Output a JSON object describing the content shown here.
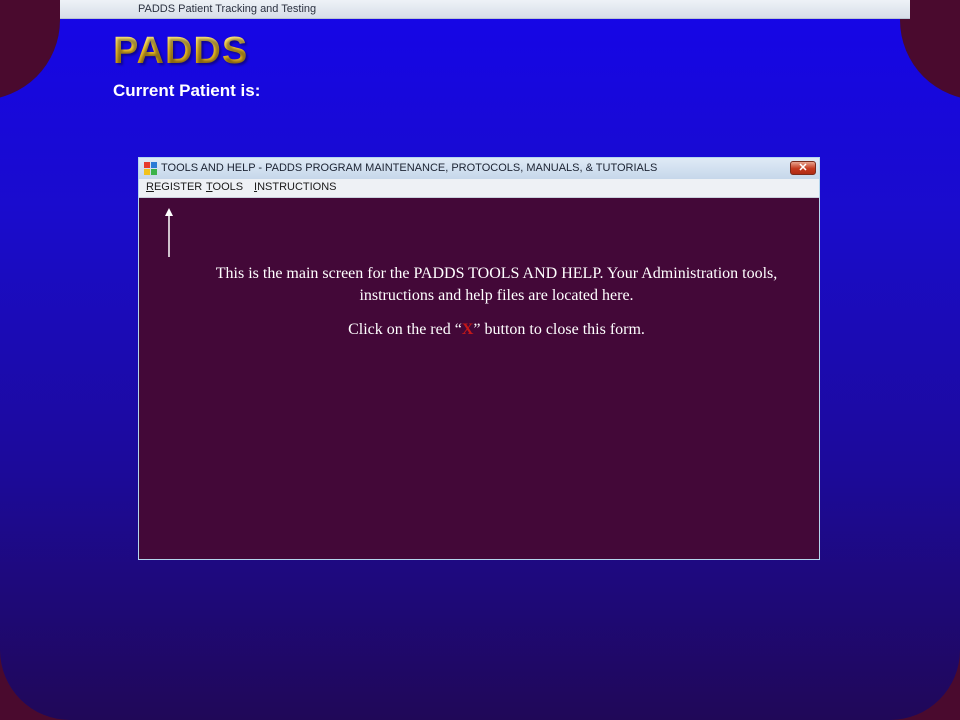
{
  "os_window": {
    "title": "PADDS Patient Tracking and Testing"
  },
  "app": {
    "logo": "PADDS",
    "current_patient_label": "Current Patient is:"
  },
  "dialog": {
    "title": "TOOLS AND HELP - PADDS PROGRAM MAINTENANCE, PROTOCOLS, MANUALS, & TUTORIALS",
    "close_label": "✕",
    "menu": [
      {
        "first": "R",
        "rest": "EGISTER"
      },
      {
        "first": "T",
        "rest": "OOLS"
      },
      {
        "first": "I",
        "rest": "NSTRUCTIONS"
      }
    ],
    "body": {
      "line1": "This is the main screen for the PADDS TOOLS AND HELP. Your Administration tools, instructions and help files are located here.",
      "line2_before": "Click on the red “",
      "line2_x": "X",
      "line2_after": "” button to close this form."
    }
  },
  "colors": {
    "background_top": "#1505e8",
    "background_bottom": "#200858",
    "frame": "#4a0a2e",
    "dialog_body": "#430838",
    "logo_gold": "#e8b81c",
    "close_red": "#c4391f",
    "highlight_red": "#c41818"
  },
  "icons": {
    "app_icon": "app-icon",
    "close": "close-icon",
    "arrow": "arrow-up-icon"
  }
}
